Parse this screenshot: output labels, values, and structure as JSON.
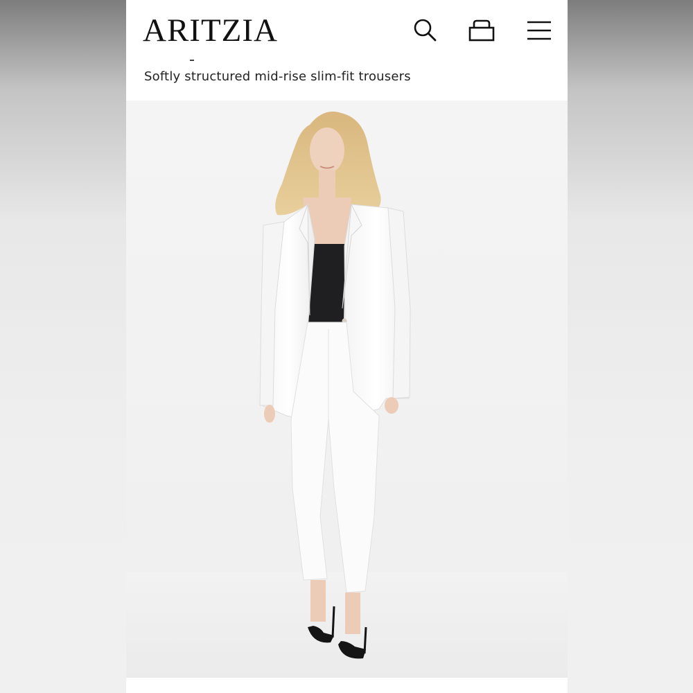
{
  "header": {
    "brand": "ARITZIA",
    "icons": [
      "search-icon",
      "shopping-bag-icon",
      "menu-icon"
    ]
  },
  "product": {
    "description": "Softly structured mid-rise slim-fit trousers"
  },
  "colors": {
    "background": "#ffffff",
    "text": "#111111",
    "photo_background": "#f2f2f2"
  }
}
